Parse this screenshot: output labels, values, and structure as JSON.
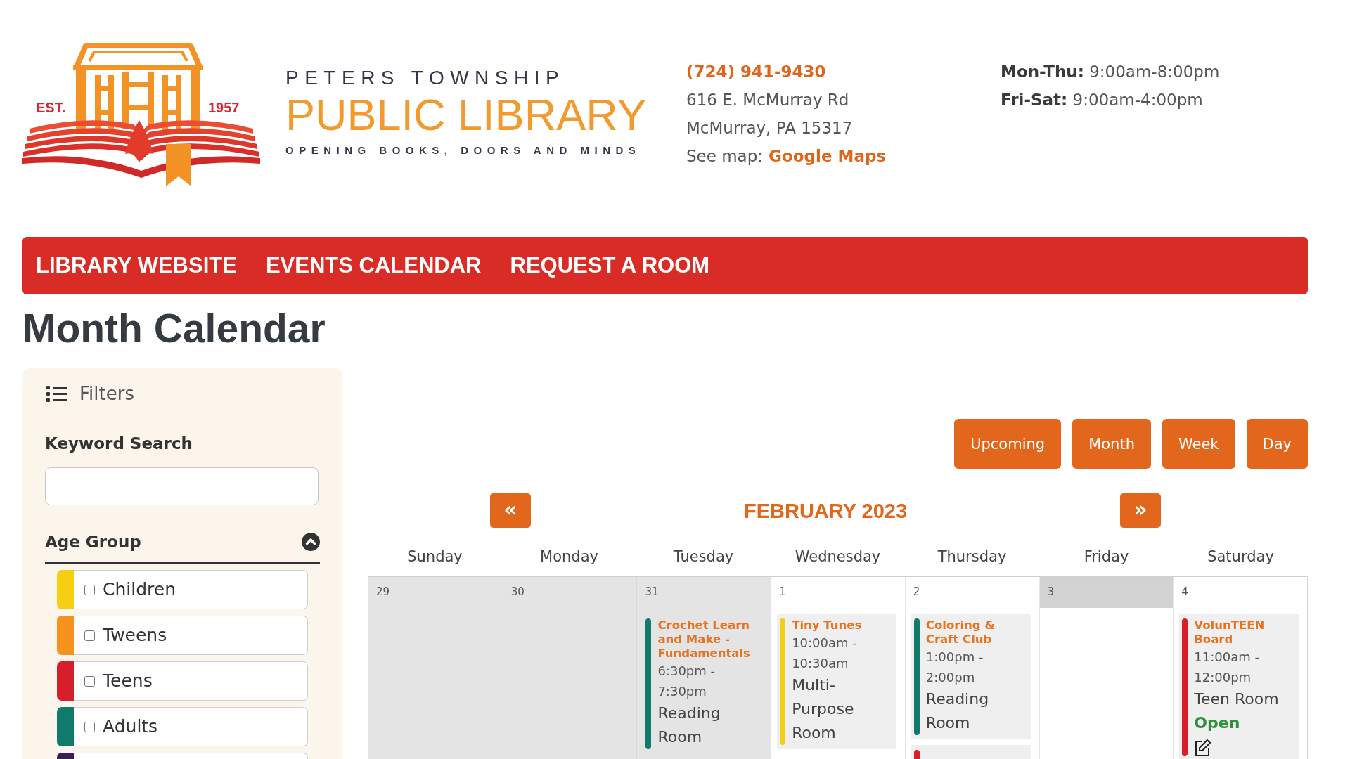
{
  "logo": {
    "established": "EST.",
    "year": "1957",
    "name_top": "PETERS TOWNSHIP",
    "name_main": "PUBLIC LIBRARY",
    "tagline": "OPENING BOOKS, DOORS AND MINDS"
  },
  "contact": {
    "phone": "(724) 941-9430",
    "address_lines": [
      "616 E. McMurray Rd",
      "McMurray, PA 15317"
    ],
    "map_label": "See map:",
    "map_link": "Google Maps"
  },
  "hours": [
    "**Mon-Thu:** 9:00am-8:00pm",
    "**Fri-Sat:** 9:00am-4:00pm"
  ],
  "nav": [
    "LIBRARY WEBSITE",
    "EVENTS CALENDAR",
    "REQUEST A ROOM"
  ],
  "page_title": "Month Calendar",
  "filters": {
    "heading": "Filters",
    "keyword_label": "Keyword Search",
    "age_group": {
      "label": "Age Group",
      "expanded": true,
      "options": [
        {
          "label": "Children",
          "checked": false,
          "color": "#f6cf13"
        },
        {
          "label": "Tweens",
          "checked": false,
          "color": "#f6921e"
        },
        {
          "label": "Teens",
          "checked": false,
          "color": "#d71f2b"
        },
        {
          "label": "Adults",
          "checked": false,
          "color": "#127a6b"
        },
        {
          "color": "#3a2050"
        }
      ]
    }
  },
  "calendar": {
    "views": [
      "Upcoming",
      "Month",
      "Week",
      "Day"
    ],
    "previous": "«",
    "title": "FEBRUARY 2023",
    "next": "»",
    "weekdays": [
      "Sunday",
      "Monday",
      "Tuesday",
      "Wednesday",
      "Thursday",
      "Friday",
      "Saturday"
    ],
    "days": [
      {
        "date": "29",
        "outside_month": true,
        "highlighted": false
      },
      {
        "date": "30",
        "outside_month": true,
        "highlighted": false
      },
      {
        "date": "31",
        "outside_month": true,
        "highlighted": false,
        "events": [
          {
            "title": "Crochet Learn and Make - Fundamentals",
            "time": "6:30pm - 7:30pm",
            "location": "Reading Room",
            "color": "#127a6b"
          }
        ]
      },
      {
        "date": "1",
        "outside_month": false,
        "highlighted": false,
        "events": [
          {
            "title": "Tiny Tunes",
            "time": "10:00am - 10:30am",
            "location": "Multi-Purpose Room",
            "color": "#f6cf13"
          }
        ]
      },
      {
        "date": "2",
        "outside_month": false,
        "highlighted": false,
        "events": [
          {
            "title": "Coloring & Craft Club",
            "time": "1:00pm - 2:00pm",
            "location": "Reading Room",
            "color": "#127a6b"
          },
          {
            "color": "#d71f2b"
          }
        ]
      },
      {
        "date": "3",
        "outside_month": false,
        "highlighted": true
      },
      {
        "date": "4",
        "outside_month": false,
        "highlighted": false,
        "events": [
          {
            "title": "VolunTEEN Board",
            "time": "11:00am - 12:00pm",
            "location": "Teen Room",
            "registration": "Open",
            "color": "#d71f2b"
          }
        ]
      }
    ]
  }
}
